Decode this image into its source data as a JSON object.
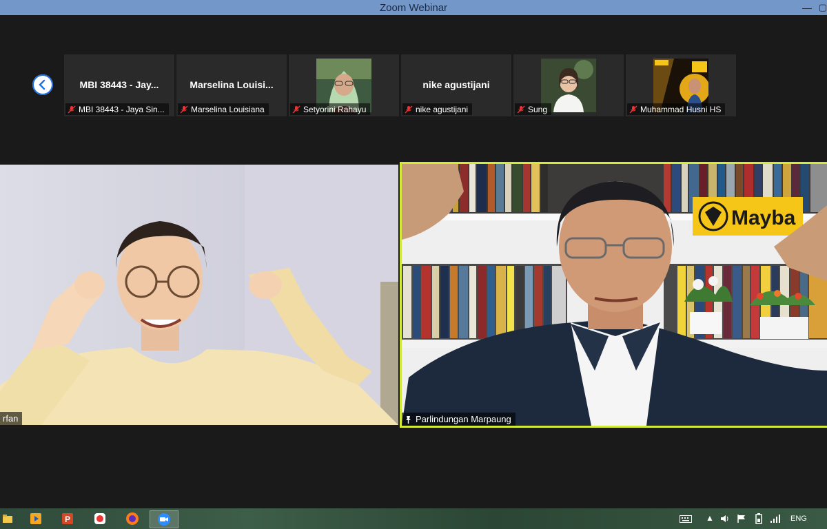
{
  "window": {
    "title": "Zoom Webinar",
    "controls": [
      "—",
      "▢"
    ]
  },
  "strip": {
    "back_icon": "chevron-left-icon",
    "thumbs": [
      {
        "name": "MBI 38443 - Jay...",
        "label": "MBI 38443 - Jaya Sin...",
        "muted": true,
        "has_video": false
      },
      {
        "name": "Marselina  Louisi...",
        "label": "Marselina Louisiana",
        "muted": true,
        "has_video": false
      },
      {
        "name": "",
        "label": "Setyorini Rahayu",
        "muted": true,
        "has_video": true
      },
      {
        "name": "nike agustijani",
        "label": "nike agustijani",
        "muted": true,
        "has_video": false
      },
      {
        "name": "",
        "label": "Sung",
        "muted": true,
        "has_video": true
      },
      {
        "name": "",
        "label": "Muhammad Husni HS",
        "muted": true,
        "has_video": true
      }
    ]
  },
  "videos": {
    "left": {
      "label": "rfan"
    },
    "right": {
      "label": "Parlindungan Marpaung",
      "sign_text": "Mayba",
      "active_speaker": true
    }
  },
  "taskbar": {
    "apps": [
      "file-explorer-icon",
      "media-player-icon",
      "powerpoint-icon",
      "recorder-icon",
      "firefox-icon",
      "zoom-icon"
    ],
    "language": "ENG"
  }
}
